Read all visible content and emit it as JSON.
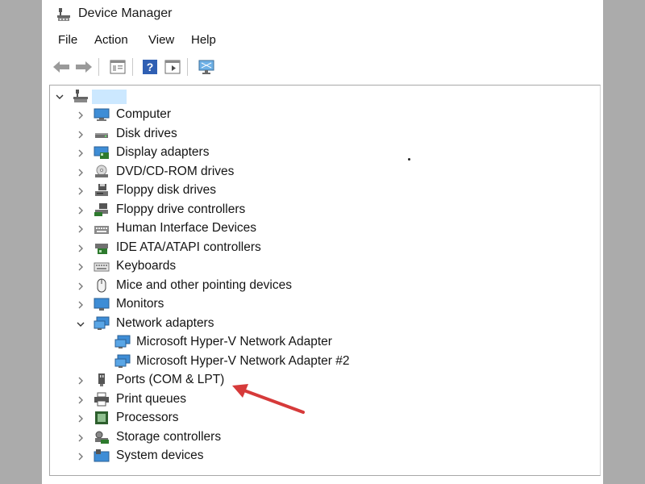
{
  "window": {
    "title": "Device Manager"
  },
  "menu": [
    "File",
    "Action",
    "View",
    "Help"
  ],
  "toolbar": [
    "back-icon",
    "forward-icon",
    "properties-icon",
    "help-icon",
    "action-view-icon",
    "monitor-icon"
  ],
  "tree": {
    "root_label": "",
    "categories": [
      {
        "label": "Computer",
        "icon": "computer-icon",
        "expanded": false
      },
      {
        "label": "Disk drives",
        "icon": "disk-drive-icon",
        "expanded": false
      },
      {
        "label": "Display adapters",
        "icon": "display-adapter-icon",
        "expanded": false
      },
      {
        "label": "DVD/CD-ROM drives",
        "icon": "dvd-icon",
        "expanded": false
      },
      {
        "label": "Floppy disk drives",
        "icon": "floppy-drive-icon",
        "expanded": false
      },
      {
        "label": "Floppy drive controllers",
        "icon": "floppy-controller-icon",
        "expanded": false
      },
      {
        "label": "Human Interface Devices",
        "icon": "hid-icon",
        "expanded": false
      },
      {
        "label": "IDE ATA/ATAPI controllers",
        "icon": "ide-controller-icon",
        "expanded": false
      },
      {
        "label": "Keyboards",
        "icon": "keyboard-icon",
        "expanded": false
      },
      {
        "label": "Mice and other pointing devices",
        "icon": "mouse-icon",
        "expanded": false
      },
      {
        "label": "Monitors",
        "icon": "monitor-icon",
        "expanded": false
      },
      {
        "label": "Network adapters",
        "icon": "network-adapter-icon",
        "expanded": true,
        "children": [
          "Microsoft Hyper-V Network Adapter",
          "Microsoft Hyper-V Network Adapter #2"
        ]
      },
      {
        "label": "Ports (COM & LPT)",
        "icon": "port-icon",
        "expanded": false
      },
      {
        "label": "Print queues",
        "icon": "printer-icon",
        "expanded": false
      },
      {
        "label": "Processors",
        "icon": "processor-icon",
        "expanded": false
      },
      {
        "label": "Storage controllers",
        "icon": "storage-controller-icon",
        "expanded": false
      },
      {
        "label": "System devices",
        "icon": "system-devices-icon",
        "expanded": false
      }
    ]
  },
  "colors": {
    "selection": "#cce8ff",
    "arrow": "#d63a3a"
  }
}
